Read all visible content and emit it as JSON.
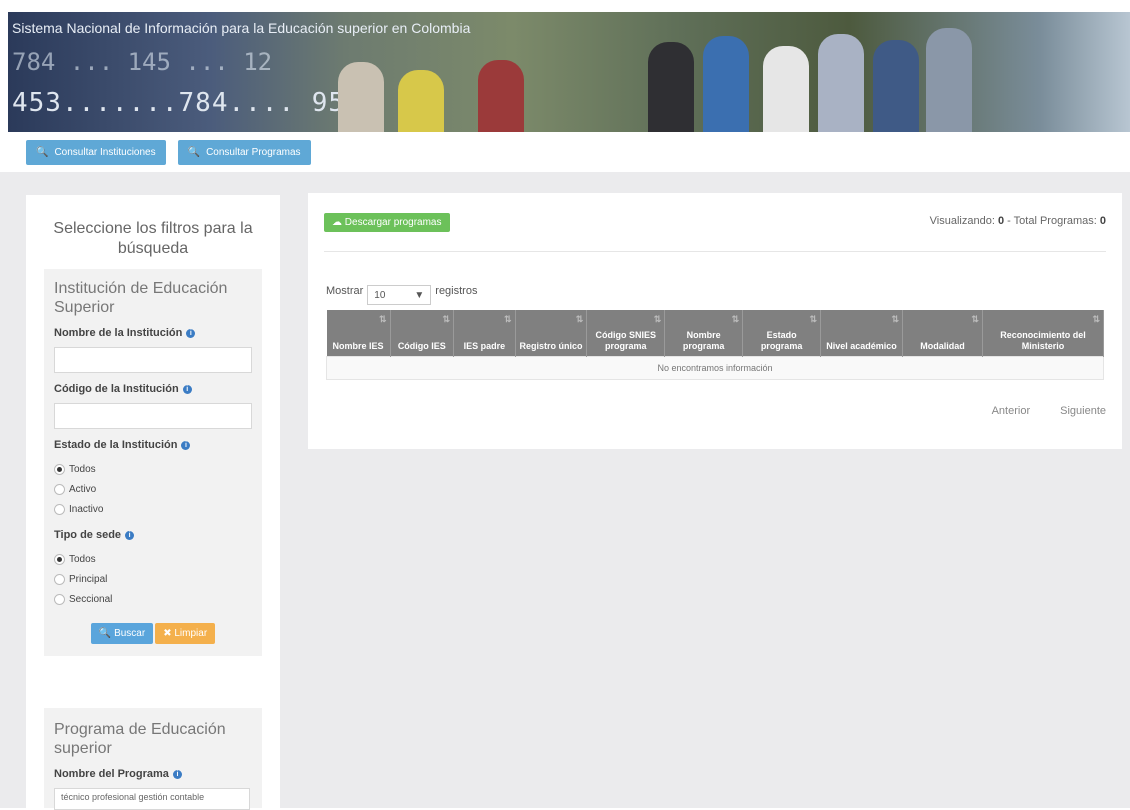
{
  "banner": {
    "title": "Sistema Nacional de Información para la Educación superior en Colombia",
    "numbers_top": "784 ... 145 ... 12",
    "numbers_bottom": "453.......784.... 95"
  },
  "topnav": {
    "consultar_instituciones": "Consultar Instituciones",
    "consultar_programas": "Consultar Programas"
  },
  "filters": {
    "title": "Seleccione los filtros para la búsqueda",
    "institucion": {
      "heading": "Institución de Educación Superior",
      "nombre_label": "Nombre de la Institución",
      "codigo_label": "Código de la Institución",
      "estado_label": "Estado de la Institución",
      "estado_options": [
        "Todos",
        "Activo",
        "Inactivo"
      ],
      "estado_selected": "Todos",
      "sede_label": "Tipo de sede",
      "sede_options": [
        "Todos",
        "Principal",
        "Seccional"
      ],
      "sede_selected": "Todos",
      "buscar": "Buscar",
      "limpiar": "Limpiar"
    },
    "programa": {
      "heading": "Programa de Educación superior",
      "nombre_label": "Nombre del Programa",
      "nombre_value": "técnico profesional gestión contable"
    }
  },
  "results": {
    "download_button": "Descargar programas",
    "visualizando_label": "Visualizando:",
    "visualizando_value": "0",
    "total_label": "- Total Programas:",
    "total_value": "0",
    "mostrar": "Mostrar",
    "page_size": "10",
    "registros": "registros",
    "columns": [
      "Nombre IES",
      "Código IES",
      "IES padre",
      "Registro único",
      "Código SNIES programa",
      "Nombre programa",
      "Estado programa",
      "Nivel académico",
      "Modalidad",
      "Reconocimiento del Ministerio"
    ],
    "empty_message": "No encontramos información",
    "anterior": "Anterior",
    "siguiente": "Siguiente"
  },
  "colors": {
    "nav_blue": "#5fa8d6",
    "download_green": "#6cc15a",
    "clear_orange": "#f4b04c",
    "table_header": "#808080"
  }
}
